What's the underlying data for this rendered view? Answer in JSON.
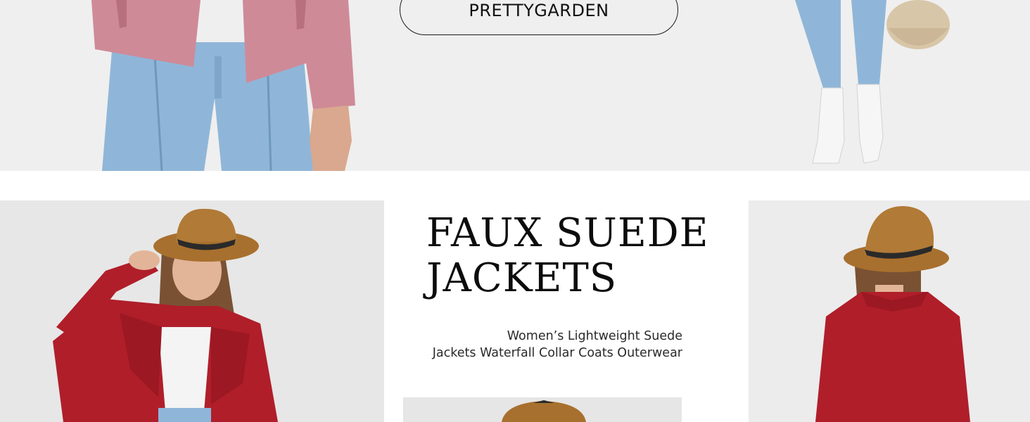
{
  "brand": {
    "button_label": "PRETTYGARDEN"
  },
  "product": {
    "title_line_1": "FAUX SUEDE",
    "title_line_2": "JACKETS",
    "description_line_1": "Women’s Lightweight Suede",
    "description_line_2": "Jackets Waterfall Collar Coats Outerwear"
  },
  "colors": {
    "band_background": "#efefef",
    "jacket_pink": "#cf8a97",
    "jacket_red": "#b01e2a",
    "denim": "#8fb6d8",
    "hat_tan": "#a8702e"
  }
}
